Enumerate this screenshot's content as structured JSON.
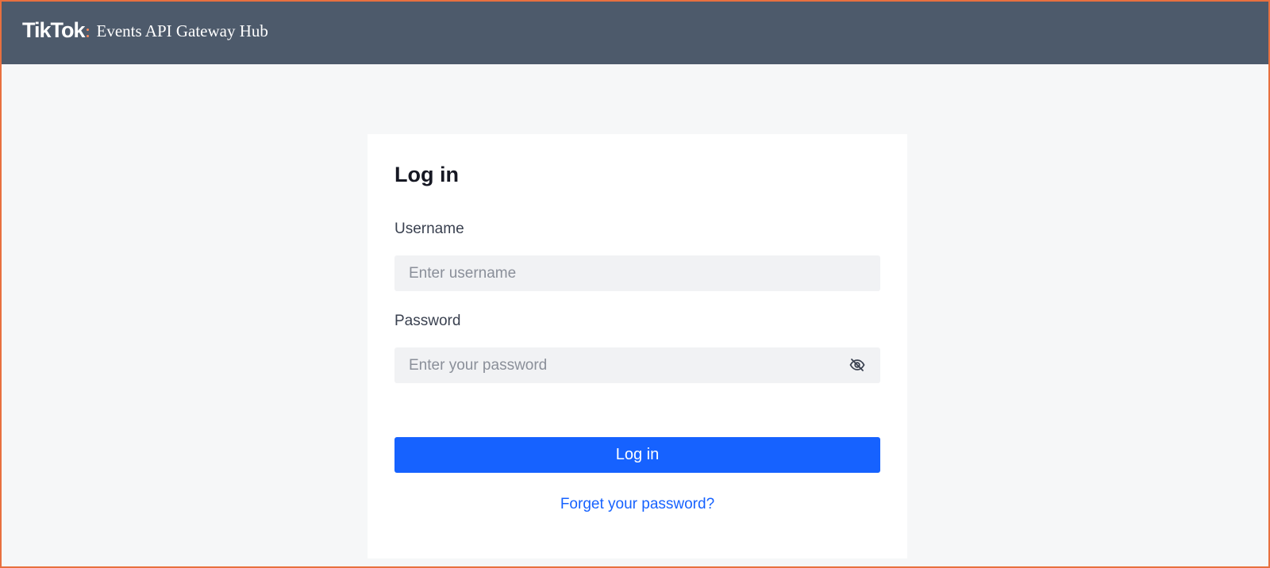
{
  "header": {
    "logo_text": "TikTok",
    "app_title": "Events API Gateway Hub"
  },
  "login": {
    "title": "Log in",
    "username": {
      "label": "Username",
      "value": "",
      "placeholder": "Enter username"
    },
    "password": {
      "label": "Password",
      "value": "",
      "placeholder": "Enter your password",
      "toggle_icon": "eye-off-icon"
    },
    "submit_label": "Log in",
    "forgot_link": "Forget your password?"
  },
  "colors": {
    "header_bg": "#4d5a6b",
    "page_bg": "#f6f7f8",
    "primary": "#1662ff",
    "frame_border": "#e8703f"
  }
}
